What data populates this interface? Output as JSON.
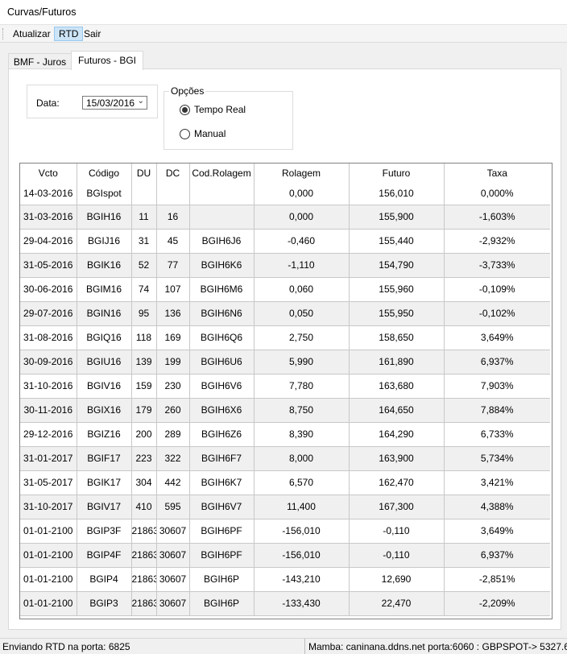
{
  "window": {
    "title": "Curvas/Futuros"
  },
  "menu": [
    {
      "label": "Atualizar",
      "active": false
    },
    {
      "label": "RTD",
      "active": true
    },
    {
      "label": "Sair",
      "active": false
    }
  ],
  "tabs": [
    {
      "label": "BMF - Juros",
      "selected": false
    },
    {
      "label": "Futuros - BGI",
      "selected": true
    }
  ],
  "date": {
    "label": "Data:",
    "value": "15/03/2016"
  },
  "options": {
    "legend": "Opções",
    "items": [
      {
        "label": "Tempo Real",
        "checked": true
      },
      {
        "label": "Manual",
        "checked": false
      }
    ]
  },
  "grid": {
    "columns": [
      "Vcto",
      "Código",
      "DU",
      "DC",
      "Cod.Rolagem",
      "Rolagem",
      "Futuro",
      "Taxa"
    ],
    "rows": [
      [
        "14-03-2016",
        "BGIspot",
        "",
        "",
        "",
        "0,000",
        "156,010",
        "0,000%"
      ],
      [
        "31-03-2016",
        "BGIH16",
        "11",
        "16",
        "",
        "0,000",
        "155,900",
        "-1,603%"
      ],
      [
        "29-04-2016",
        "BGIJ16",
        "31",
        "45",
        "BGIH6J6",
        "-0,460",
        "155,440",
        "-2,932%"
      ],
      [
        "31-05-2016",
        "BGIK16",
        "52",
        "77",
        "BGIH6K6",
        "-1,110",
        "154,790",
        "-3,733%"
      ],
      [
        "30-06-2016",
        "BGIM16",
        "74",
        "107",
        "BGIH6M6",
        "0,060",
        "155,960",
        "-0,109%"
      ],
      [
        "29-07-2016",
        "BGIN16",
        "95",
        "136",
        "BGIH6N6",
        "0,050",
        "155,950",
        "-0,102%"
      ],
      [
        "31-08-2016",
        "BGIQ16",
        "118",
        "169",
        "BGIH6Q6",
        "2,750",
        "158,650",
        "3,649%"
      ],
      [
        "30-09-2016",
        "BGIU16",
        "139",
        "199",
        "BGIH6U6",
        "5,990",
        "161,890",
        "6,937%"
      ],
      [
        "31-10-2016",
        "BGIV16",
        "159",
        "230",
        "BGIH6V6",
        "7,780",
        "163,680",
        "7,903%"
      ],
      [
        "30-11-2016",
        "BGIX16",
        "179",
        "260",
        "BGIH6X6",
        "8,750",
        "164,650",
        "7,884%"
      ],
      [
        "29-12-2016",
        "BGIZ16",
        "200",
        "289",
        "BGIH6Z6",
        "8,390",
        "164,290",
        "6,733%"
      ],
      [
        "31-01-2017",
        "BGIF17",
        "223",
        "322",
        "BGIH6F7",
        "8,000",
        "163,900",
        "5,734%"
      ],
      [
        "31-05-2017",
        "BGIK17",
        "304",
        "442",
        "BGIH6K7",
        "6,570",
        "162,470",
        "3,421%"
      ],
      [
        "31-10-2017",
        "BGIV17",
        "410",
        "595",
        "BGIH6V7",
        "11,400",
        "167,300",
        "4,388%"
      ],
      [
        "01-01-2100",
        "BGIP3F",
        "21863",
        "30607",
        "BGIH6PF",
        "-156,010",
        "-0,110",
        "3,649%"
      ],
      [
        "01-01-2100",
        "BGIP4F",
        "21863",
        "30607",
        "BGIH6PF",
        "-156,010",
        "-0,110",
        "6,937%"
      ],
      [
        "01-01-2100",
        "BGIP4",
        "21863",
        "30607",
        "BGIH6P",
        "-143,210",
        "12,690",
        "-2,851%"
      ],
      [
        "01-01-2100",
        "BGIP3",
        "21863",
        "30607",
        "BGIH6P",
        "-133,430",
        "22,470",
        "-2,209%"
      ]
    ]
  },
  "status": {
    "left": "Enviando RTD na porta: 6825",
    "right": "Mamba: caninana.ddns.net porta:6060 : GBPSPOT-> 5327.6"
  },
  "icons": {
    "date_dropdown": "chevron-down-icon"
  },
  "colors": {
    "menu_active_bg": "#cce4f7",
    "row_alt_bg": "#f0f0f0"
  }
}
